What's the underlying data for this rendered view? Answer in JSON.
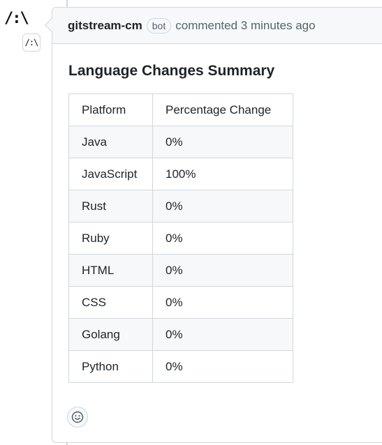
{
  "avatar": {
    "glyph": "/:\\",
    "badge_glyph": "/:\\"
  },
  "comment": {
    "author": "gitstream-cm",
    "bot_label": "bot",
    "meta": "commented 3 minutes ago",
    "title": "Language Changes Summary",
    "table": {
      "headers": [
        "Platform",
        "Percentage Change"
      ],
      "rows": [
        [
          "Java",
          "0%"
        ],
        [
          "JavaScript",
          "100%"
        ],
        [
          "Rust",
          "0%"
        ],
        [
          "Ruby",
          "0%"
        ],
        [
          "HTML",
          "0%"
        ],
        [
          "CSS",
          "0%"
        ],
        [
          "Golang",
          "0%"
        ],
        [
          "Python",
          "0%"
        ]
      ]
    },
    "reaction_icon": "smiley-icon"
  },
  "colors": {
    "border": "#d0d7de",
    "header_bg": "#f6f8fa",
    "muted_text": "#59636e"
  }
}
